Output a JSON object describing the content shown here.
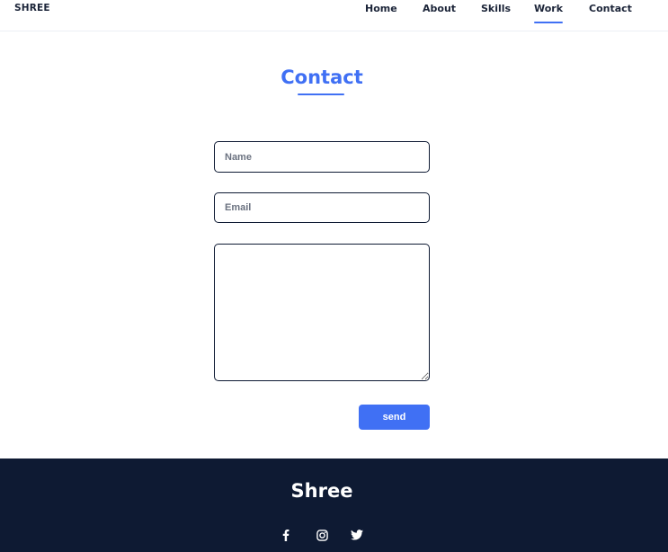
{
  "header": {
    "logo": "SHREE",
    "nav": [
      {
        "label": "Home",
        "active": false
      },
      {
        "label": "About",
        "active": false
      },
      {
        "label": "Skills",
        "active": false
      },
      {
        "label": "Work",
        "active": true
      },
      {
        "label": "Contact",
        "active": false
      }
    ]
  },
  "contact": {
    "title": "Contact",
    "name_placeholder": "Name",
    "email_placeholder": "Email",
    "message_placeholder": "",
    "send_label": "send"
  },
  "footer": {
    "brand": "Shree",
    "social": [
      "facebook-icon",
      "instagram-icon",
      "twitter-icon"
    ]
  },
  "colors": {
    "accent": "#4070f4",
    "dark": "#0e1a33",
    "background": "#ffffff"
  }
}
